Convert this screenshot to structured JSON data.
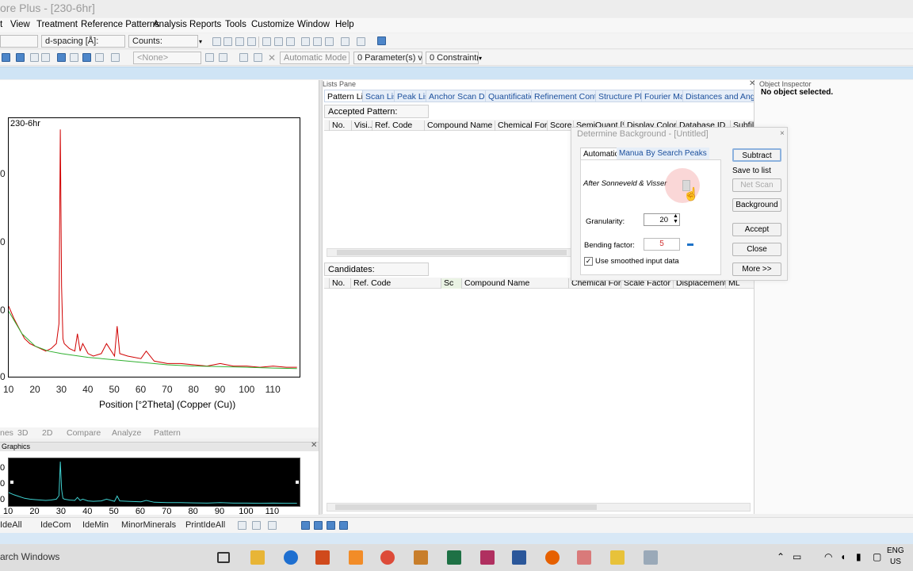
{
  "window": {
    "title": "ore Plus - [230-6hr]"
  },
  "menu": [
    "t",
    "View",
    "Treatment",
    "Reference Patterns",
    "Analysis",
    "Reports",
    "Tools",
    "Customize",
    "Window",
    "Help"
  ],
  "toolbar1": {
    "field_d_spacing": "d-spacing [Å]:",
    "field_counts": "Counts:"
  },
  "toolbar2": {
    "none_select": "<None>",
    "mode_select": "Automatic Mode",
    "parameters": "0 Parameter(s) var",
    "constraints": "0 Constraint(s"
  },
  "plot": {
    "title": "230-6hr",
    "xlabel": "Position [°2Theta] (Copper (Cu))",
    "xticks": [
      "10",
      "20",
      "30",
      "40",
      "50",
      "60",
      "70",
      "80",
      "90",
      "100",
      "110"
    ],
    "y_partial_ticks": [
      "0",
      "0",
      "0",
      "0"
    ]
  },
  "chart_data": {
    "type": "line",
    "title": "230-6hr",
    "xlabel": "Position [°2Theta] (Copper (Cu))",
    "xlim": [
      10,
      120
    ],
    "series": [
      {
        "color": "#d00000",
        "x": [
          10,
          12,
          14,
          16,
          18,
          20,
          22,
          24,
          26,
          28,
          29,
          29.5,
          30,
          30.5,
          31,
          33,
          35,
          36,
          37,
          38,
          40,
          42,
          45,
          47,
          50,
          51,
          52,
          55,
          60,
          62,
          65,
          70,
          75,
          80,
          85,
          90,
          95,
          100,
          105,
          110,
          115,
          119
        ],
        "y": [
          0.27,
          0.22,
          0.18,
          0.14,
          0.12,
          0.11,
          0.1,
          0.09,
          0.1,
          0.12,
          0.2,
          0.98,
          0.35,
          0.14,
          0.12,
          0.1,
          0.09,
          0.16,
          0.09,
          0.12,
          0.08,
          0.07,
          0.08,
          0.12,
          0.07,
          0.19,
          0.08,
          0.07,
          0.06,
          0.09,
          0.05,
          0.04,
          0.04,
          0.035,
          0.03,
          0.04,
          0.03,
          0.03,
          0.025,
          0.03,
          0.025,
          0.025
        ]
      },
      {
        "color": "#30b030",
        "x": [
          10,
          15,
          20,
          25,
          30,
          40,
          50,
          60,
          70,
          80,
          90,
          100,
          110,
          119
        ],
        "y": [
          0.25,
          0.16,
          0.11,
          0.09,
          0.08,
          0.065,
          0.055,
          0.045,
          0.035,
          0.03,
          0.028,
          0.025,
          0.022,
          0.02
        ]
      }
    ]
  },
  "left_tabs": [
    "nes",
    "3D",
    "2D",
    "Compare",
    "Analyze",
    "Pattern"
  ],
  "graphics_label": "Graphics",
  "overview": {
    "y_ticks": [
      "0",
      "0",
      "0"
    ],
    "xticks": [
      "10",
      "20",
      "30",
      "40",
      "50",
      "60",
      "70",
      "80",
      "90",
      "100",
      "110"
    ]
  },
  "lists_pane": {
    "title": "Lists Pane",
    "tabs": [
      "Pattern List",
      "Scan List",
      "Peak List",
      "Anchor Scan Data",
      "Quantification",
      "Refinement Control",
      "Structure Plot",
      "Fourier Map",
      "Distances and Angles"
    ],
    "accepted_label": "Accepted Pattern:",
    "accepted_columns": [
      "No.",
      "Visi...",
      "Ref. Code",
      "Compound Name",
      "Chemical For...",
      "Score",
      "SemiQuant [%]",
      "Display Color",
      "Database ID",
      "Subfil"
    ],
    "candidates_label": "Candidates:",
    "candidate_columns": [
      "No.",
      "Ref. Code",
      "Sc",
      "Compound Name",
      "Chemical For...",
      "Scale Factor",
      "Displacement...",
      "ML"
    ]
  },
  "dialog": {
    "title": "Determine Background - [Untitled]",
    "tabs": [
      "Automatic",
      "Manual",
      "By Search Peaks"
    ],
    "method_label": "After Sonneveld & Visser",
    "granularity_label": "Granularity:",
    "granularity_value": "20",
    "bending_label": "Bending factor:",
    "bending_value": "5",
    "smoothed_label": "Use smoothed input data",
    "buttons": {
      "subtract": "Subtract",
      "save_to_list": "Save to list",
      "net_scan": "Net Scan",
      "background": "Background",
      "accept": "Accept",
      "close": "Close",
      "more": "More >>"
    }
  },
  "inspector": {
    "title": "Object Inspector",
    "status": "No object selected."
  },
  "statusbar": {
    "items": [
      "IdeAll",
      "IdeCom",
      "IdeMin",
      "MinorMinerals",
      "PrintIdeAll"
    ]
  },
  "taskbar": {
    "search": "arch Windows",
    "lang": "ENG",
    "region": "US"
  }
}
